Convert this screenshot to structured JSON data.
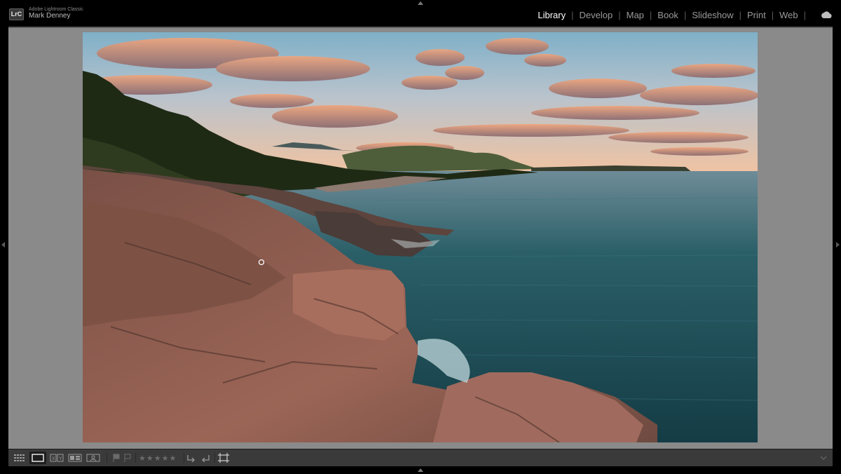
{
  "app": {
    "badge": "LrC",
    "name": "Adobe Lightroom Classic",
    "user": "Mark Denney"
  },
  "modules": [
    {
      "label": "Library",
      "active": true
    },
    {
      "label": "Develop",
      "active": false
    },
    {
      "label": "Map",
      "active": false
    },
    {
      "label": "Book",
      "active": false
    },
    {
      "label": "Slideshow",
      "active": false
    },
    {
      "label": "Print",
      "active": false
    },
    {
      "label": "Web",
      "active": false
    }
  ],
  "module_separator": "|",
  "toolbar": {
    "view_modes": [
      "grid-view-icon",
      "loupe-view-icon",
      "compare-view-icon",
      "survey-view-icon",
      "people-view-icon"
    ],
    "active_view": "loupe-view-icon",
    "flags": [
      "flag-pick-icon",
      "flag-reject-icon"
    ],
    "rating": "★★★★★",
    "rating_value": 0,
    "rotate": [
      "rotate-left-icon",
      "rotate-right-icon"
    ],
    "crop_icon": "crop-overlay-icon"
  },
  "photo": {
    "subject": "coastal-landscape",
    "colors": {
      "sky_top": "#7fb0c8",
      "sky_horizon": "#f2c3a0",
      "cloud": "#e8906a",
      "sea": "#1d4b55",
      "rock": "#8a5a4e",
      "forest": "#1f2a15"
    }
  },
  "colors": {
    "background": "#000000",
    "content_background": "#8a8a8a",
    "active_module": "#ffffff",
    "inactive_module": "#9a9a9a",
    "toolbar": "#3a3a3a"
  }
}
